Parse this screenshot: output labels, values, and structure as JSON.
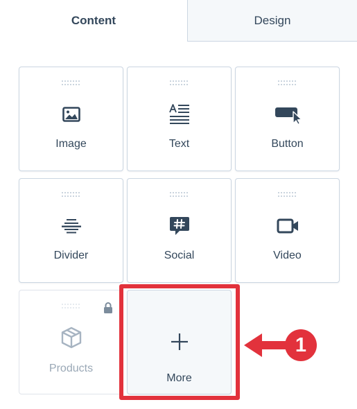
{
  "tabs": [
    {
      "label": "Content",
      "active": true
    },
    {
      "label": "Design",
      "active": false
    }
  ],
  "modules": [
    {
      "label": "Image",
      "icon": "image-icon"
    },
    {
      "label": "Text",
      "icon": "text-align-icon"
    },
    {
      "label": "Button",
      "icon": "button-cursor-icon"
    },
    {
      "label": "Divider",
      "icon": "divider-icon"
    },
    {
      "label": "Social",
      "icon": "hashtag-chat-icon"
    },
    {
      "label": "Video",
      "icon": "video-camera-icon"
    },
    {
      "label": "Products",
      "icon": "box-icon",
      "locked": true,
      "lock_icon": "lock-icon"
    },
    {
      "label": "More",
      "icon": "plus-icon"
    }
  ],
  "annotation": {
    "number": "1",
    "icon": "arrow-left-icon",
    "color": "#e2323c"
  },
  "colors": {
    "text": "#33475b",
    "border": "#cbd6e2",
    "tab_inactive_bg": "#f5f8fa",
    "highlight": "#e2323c"
  }
}
